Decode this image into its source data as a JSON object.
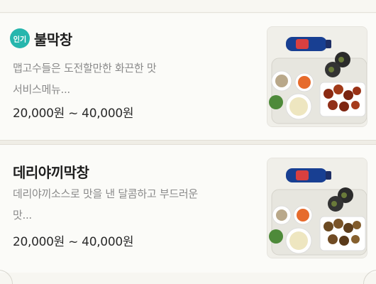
{
  "items": [
    {
      "badge": "인기",
      "name": "불막창",
      "desc_line1": "맵고수들은 도전할만한 화끈한 맛",
      "desc_line2": "서비스메뉴...",
      "price": "20,000원 ~ 40,000원",
      "image": "food-set-photo"
    },
    {
      "name": "데리야끼막창",
      "desc_line1": "데리야끼소스로 맛을 낸 달콤하고 부드러운",
      "desc_line2": "맛...",
      "price": "20,000원 ~ 40,000원",
      "image": "food-set-photo"
    }
  ],
  "colors": {
    "badge": "#26b6ad",
    "background": "#f7f6f1",
    "price_text": "#2a2a2a",
    "desc_text": "#8a8a8a"
  }
}
